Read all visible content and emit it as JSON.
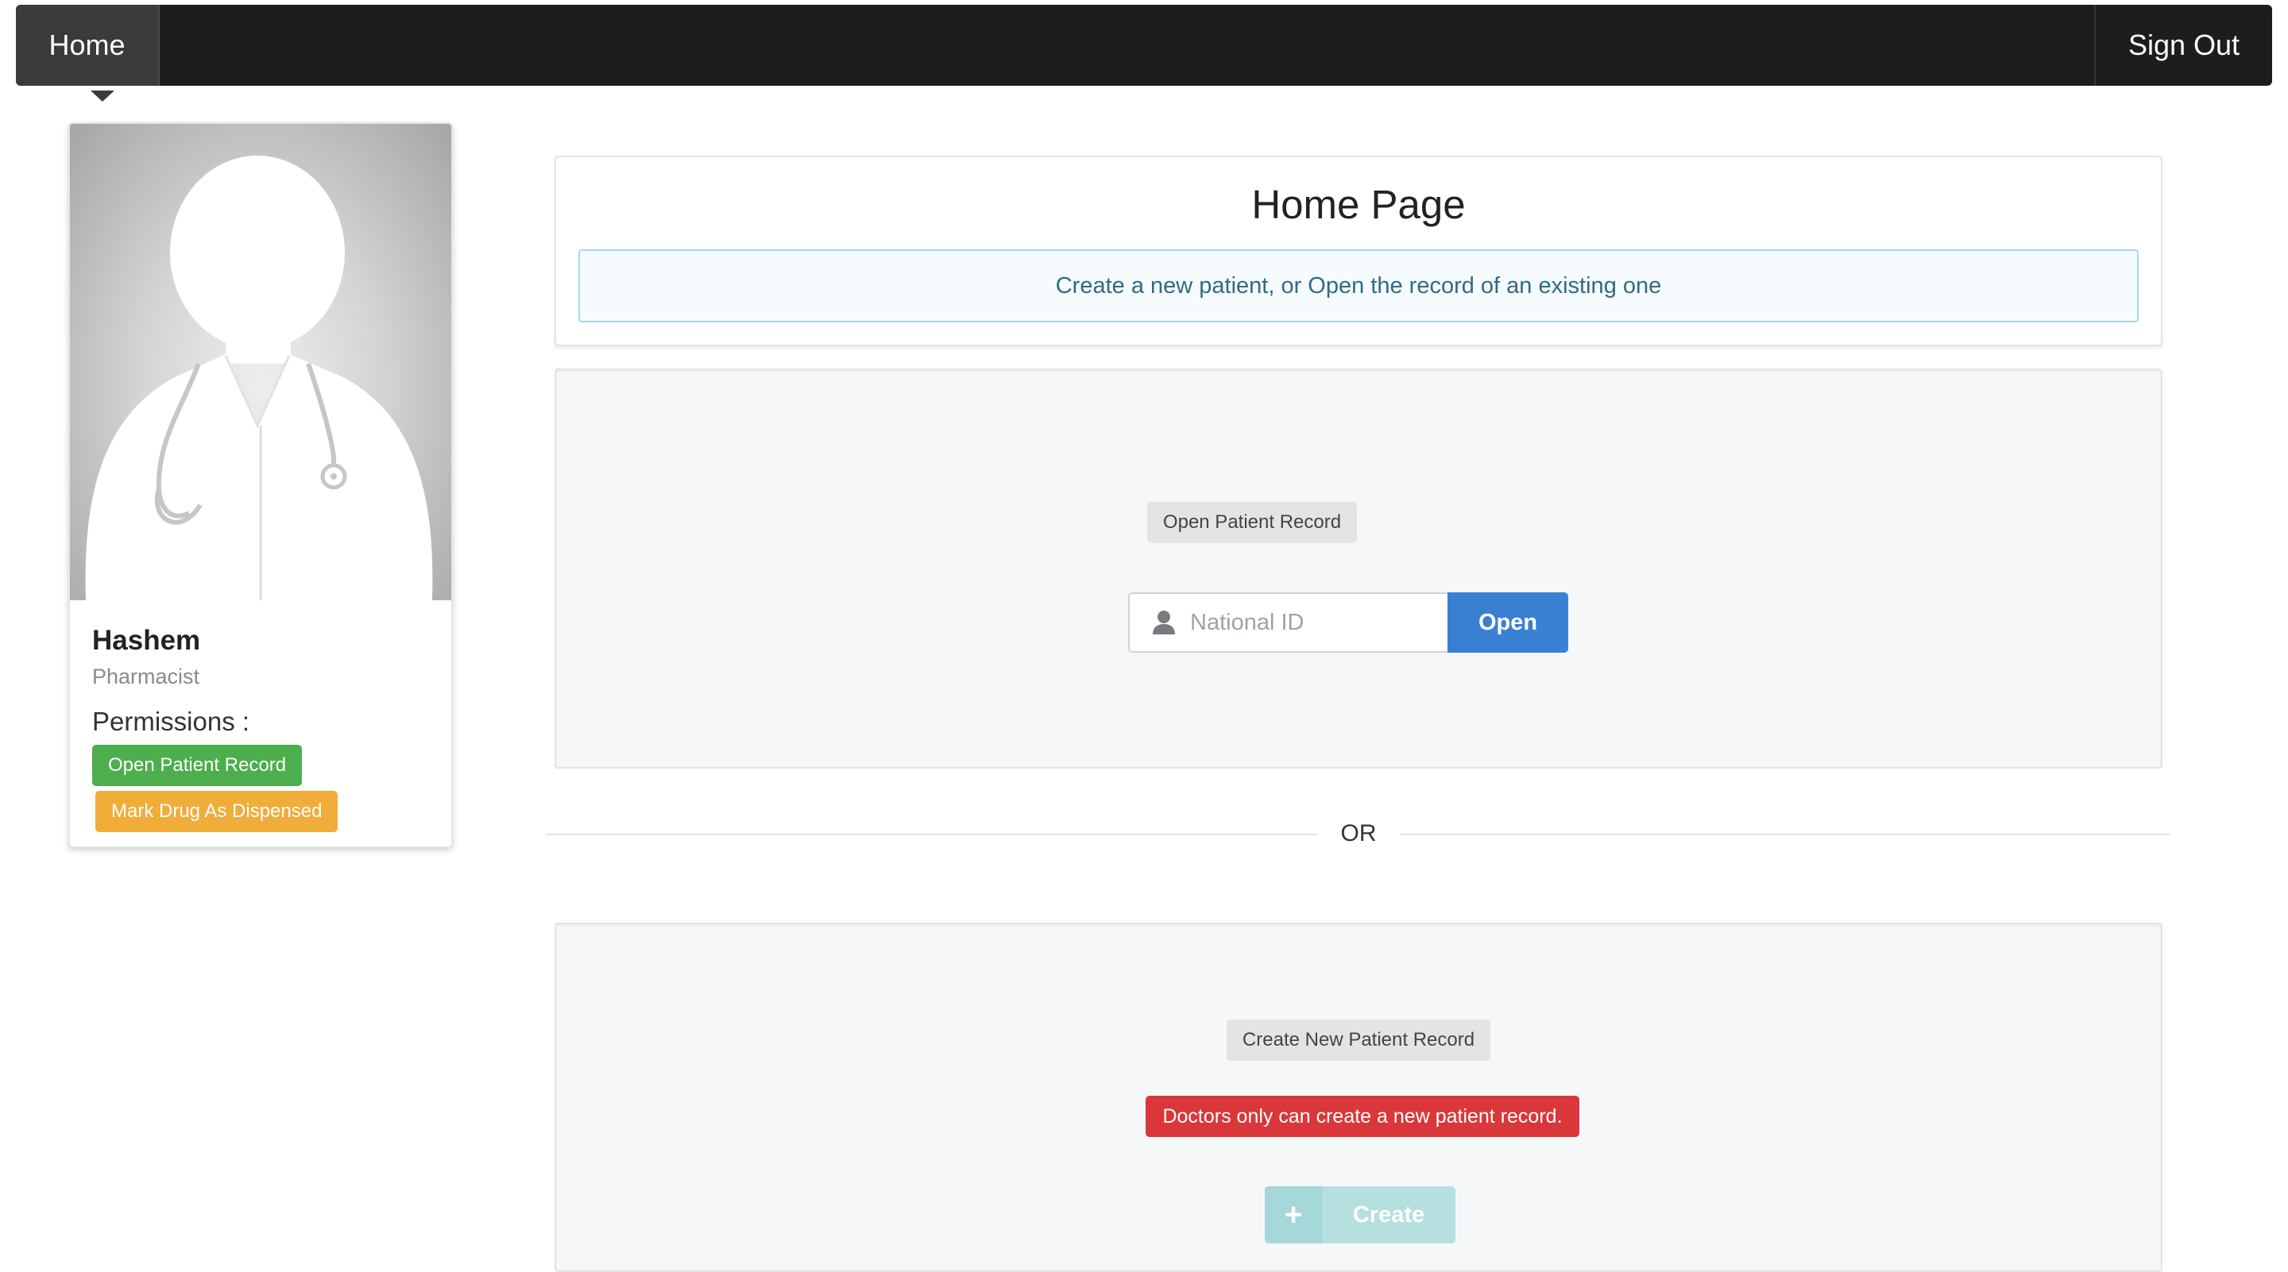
{
  "navbar": {
    "home_label": "Home",
    "signout_label": "Sign Out"
  },
  "profile": {
    "avatar_icon": "doctor-avatar-icon",
    "name": "Hashem",
    "role": "Pharmacist",
    "permissions_label": "Permissions :",
    "permissions": [
      {
        "label": "Open Patient Record",
        "color": "#4cae4c"
      },
      {
        "label": "Mark Drug As Dispensed",
        "color": "#f0ad3a"
      }
    ]
  },
  "header": {
    "title": "Home Page",
    "info": "Create a new patient, or Open the record of an existing one"
  },
  "open_section": {
    "label": "Open Patient Record",
    "input_icon": "user-icon",
    "input_placeholder": "National ID",
    "input_value": "",
    "button_label": "Open",
    "button_color": "#3a80d2"
  },
  "divider": {
    "text": "OR"
  },
  "create_section": {
    "label": "Create New Patient Record",
    "error": "Doctors only can create a new patient record.",
    "error_color": "#d9373a",
    "button_icon": "plus-icon",
    "button_label": "Create",
    "button_glyph": "+"
  }
}
